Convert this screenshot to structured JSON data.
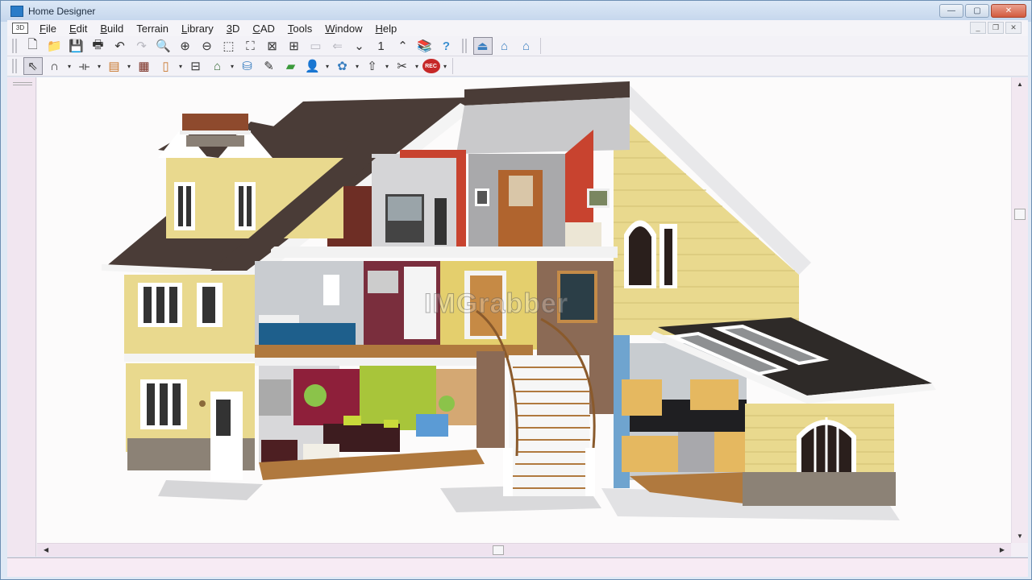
{
  "window": {
    "title": "Home Designer",
    "controls": {
      "minimize": "—",
      "maximize": "▢",
      "close": "✕"
    },
    "mdi_controls": {
      "minimize": "_",
      "restore": "❐",
      "close": "✕"
    }
  },
  "menubar": {
    "doc_icon": "3D",
    "items": [
      {
        "label": "File",
        "accel": "F",
        "rest": "ile"
      },
      {
        "label": "Edit",
        "accel": "E",
        "rest": "dit"
      },
      {
        "label": "Build",
        "accel": "B",
        "rest": "uild"
      },
      {
        "label": "Terrain",
        "accel": "",
        "rest": "Terrain"
      },
      {
        "label": "Library",
        "accel": "L",
        "rest": "ibrary"
      },
      {
        "label": "3D",
        "accel": "3",
        "rest": "D"
      },
      {
        "label": "CAD",
        "accel": "C",
        "rest": "AD"
      },
      {
        "label": "Tools",
        "accel": "T",
        "rest": "ools"
      },
      {
        "label": "Window",
        "accel": "W",
        "rest": "indow"
      },
      {
        "label": "Help",
        "accel": "H",
        "rest": "elp"
      }
    ]
  },
  "toolbar1": {
    "buttons": [
      {
        "name": "new-file-icon",
        "glyph": "🗋"
      },
      {
        "name": "open-folder-icon",
        "glyph": "📁"
      },
      {
        "name": "save-icon",
        "glyph": "💾"
      },
      {
        "name": "print-icon",
        "glyph": "🖶"
      },
      {
        "name": "undo-icon",
        "glyph": "↶"
      },
      {
        "name": "redo-icon",
        "glyph": "↷"
      },
      {
        "name": "zoom-icon",
        "glyph": "🔍"
      },
      {
        "name": "zoom-in-icon",
        "glyph": "⊕"
      },
      {
        "name": "zoom-out-icon",
        "glyph": "⊖"
      },
      {
        "name": "zoom-box-icon",
        "glyph": "⬚"
      },
      {
        "name": "fill-window-icon",
        "glyph": "⛶"
      },
      {
        "name": "fit-view-icon",
        "glyph": "⊠"
      },
      {
        "name": "pan-icon",
        "glyph": "⊞"
      },
      {
        "name": "layer-icon",
        "glyph": "▭"
      },
      {
        "name": "move-icon",
        "glyph": "⇐"
      },
      {
        "name": "floor-down-icon",
        "glyph": "⌄"
      },
      {
        "name": "floor-number-icon",
        "glyph": "1"
      },
      {
        "name": "floor-up-icon",
        "glyph": "⌃"
      },
      {
        "name": "library-book-icon",
        "glyph": "📚"
      },
      {
        "name": "help-icon",
        "glyph": "?"
      },
      {
        "name": "camera-exterior-icon",
        "glyph": "⏏"
      },
      {
        "name": "camera-overview-icon",
        "glyph": "⌂"
      },
      {
        "name": "camera-dollhouse-icon",
        "glyph": "⌂"
      }
    ]
  },
  "toolbar2": {
    "buttons": [
      {
        "name": "select-arrow-icon",
        "glyph": "⇖",
        "dropdown": false
      },
      {
        "name": "spline-icon",
        "glyph": "∩",
        "dropdown": true
      },
      {
        "name": "wall-icon",
        "glyph": "⟛",
        "dropdown": true
      },
      {
        "name": "cabinet-icon",
        "glyph": "▤",
        "dropdown": true
      },
      {
        "name": "fireplace-icon",
        "glyph": "▦",
        "dropdown": false
      },
      {
        "name": "door-icon",
        "glyph": "▯",
        "dropdown": true
      },
      {
        "name": "window-tool-icon",
        "glyph": "⊟",
        "dropdown": false
      },
      {
        "name": "house-photo-icon",
        "glyph": "⌂",
        "dropdown": true
      },
      {
        "name": "paint-bucket-icon",
        "glyph": "⛁",
        "dropdown": false
      },
      {
        "name": "eyedropper-icon",
        "glyph": "✎",
        "dropdown": false
      },
      {
        "name": "material-brush-icon",
        "glyph": "▰",
        "dropdown": false
      },
      {
        "name": "people-icon",
        "glyph": "👤",
        "dropdown": true
      },
      {
        "name": "object-icon",
        "glyph": "✿",
        "dropdown": true
      },
      {
        "name": "arrow-up-icon",
        "glyph": "⇧",
        "dropdown": true
      },
      {
        "name": "dimension-icon",
        "glyph": "✂",
        "dropdown": true
      },
      {
        "name": "record-icon",
        "glyph": "REC",
        "dropdown": true
      }
    ]
  },
  "canvas": {
    "watermark": "IMGrabber",
    "scene": "3D cutaway dollhouse view of two-story house"
  },
  "colors": {
    "siding": "#e9d98e",
    "roof": "#4a3c37",
    "trim": "#ffffff",
    "stone": "#8c8276",
    "floor": "#b0793e",
    "accent_red": "#c8432f",
    "kitchen_blue": "#6fa4cf"
  }
}
